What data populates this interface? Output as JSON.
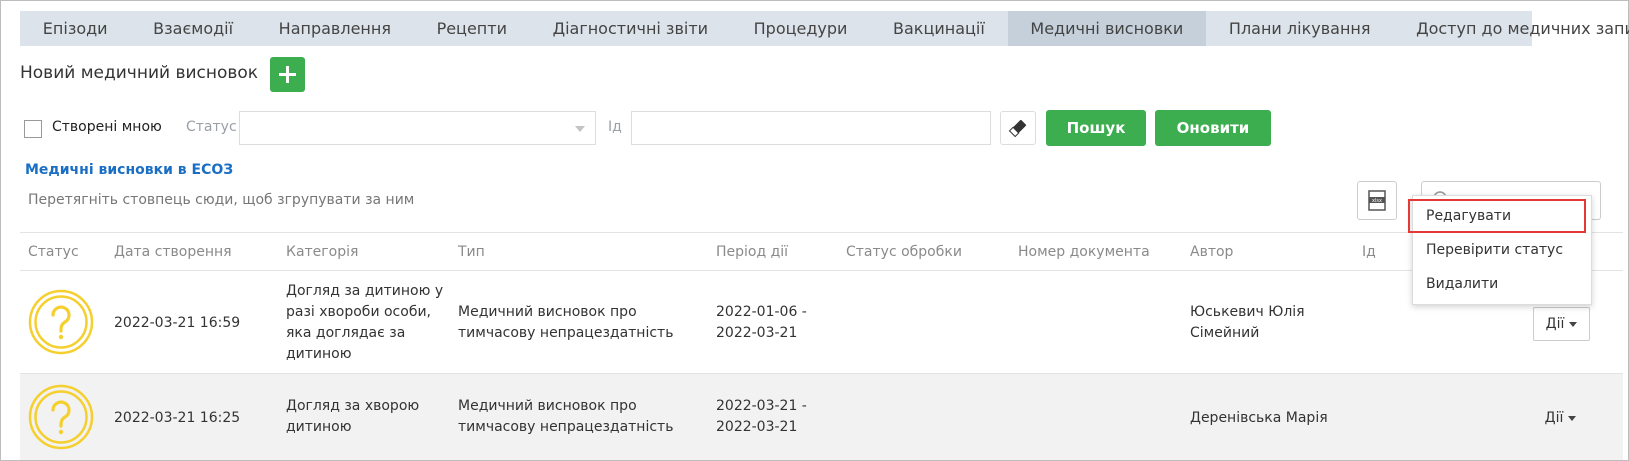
{
  "tabs": [
    {
      "label": "Епізоди"
    },
    {
      "label": "Взаємодії"
    },
    {
      "label": "Направлення"
    },
    {
      "label": "Рецепти"
    },
    {
      "label": "Діагностичні звіти"
    },
    {
      "label": "Процедури"
    },
    {
      "label": "Вакцинації"
    },
    {
      "label": "Медичні висновки",
      "active": true
    },
    {
      "label": "Плани лікування"
    },
    {
      "label": "Доступ до медичних записів"
    }
  ],
  "header": {
    "new_title": "Новий медичний висновок"
  },
  "filters": {
    "created_by_me": "Створені мною",
    "status_label": "Статус",
    "status_value": "",
    "id_label": "Ід",
    "id_value": "",
    "search_button": "Пошук",
    "refresh_button": "Оновити"
  },
  "grid": {
    "title": "Медичні висновки в ЕСОЗ",
    "group_hint": "Перетягніть стовпець сюди, щоб згрупувати за ним",
    "columns": [
      "Статус",
      "Дата створення",
      "Категорія",
      "Тип",
      "Період дії",
      "Статус обробки",
      "Номер документа",
      "Автор",
      "Ід"
    ],
    "rows": [
      {
        "date": "2022-03-21 16:59",
        "category": [
          "Догляд за дитиною у",
          "разі хвороби особи,",
          "яка доглядає за",
          "дитиною"
        ],
        "type": [
          "Медичний висновок про",
          "тимчасову непрацездатність"
        ],
        "period": [
          "2022-01-06 -",
          "2022-03-21"
        ],
        "author": [
          "Юськевич Юлія",
          "Сімейний"
        ],
        "actions": "Дії"
      },
      {
        "date": "2022-03-21 16:25",
        "category": [
          "Догляд за хворою",
          "дитиною"
        ],
        "type": [
          "Медичний висновок про",
          "тимчасову непрацездатність"
        ],
        "period": [
          "2022-03-21 -",
          "2022-03-21"
        ],
        "author": [
          "Деренівська Марія"
        ],
        "actions": "Дії"
      }
    ]
  },
  "menu": {
    "items": [
      "Редагувати",
      "Перевірити статус",
      "Видалити"
    ]
  },
  "colors": {
    "accent_green": "#3dae50",
    "link_blue": "#1a6fc4",
    "status_yellow": "#f5cf2e",
    "highlight_red": "#e53935"
  }
}
